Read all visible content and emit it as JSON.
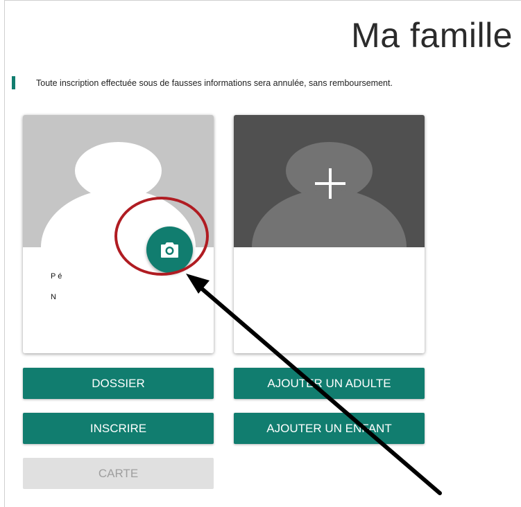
{
  "header": {
    "title": "Ma famille"
  },
  "notice": {
    "text": "Toute inscription effectuée sous de fausses informations sera annulée, sans remboursement."
  },
  "member_card": {
    "info_lines": [
      "P é",
      "N"
    ],
    "camera_button_icon": "camera-icon"
  },
  "add_card": {
    "icon": "plus-icon"
  },
  "actions": {
    "dossier": "DOSSIER",
    "inscrire": "INSCRIRE",
    "carte": "CARTE",
    "ajouter_adulte": "AJOUTER UN ADULTE",
    "ajouter_enfant": "AJOUTER UN ENFANT"
  },
  "colors": {
    "accent": "#117d6f",
    "annotation_circle": "#b01c22",
    "annotation_arrow": "#000000",
    "disabled": "#e0e0e0"
  }
}
